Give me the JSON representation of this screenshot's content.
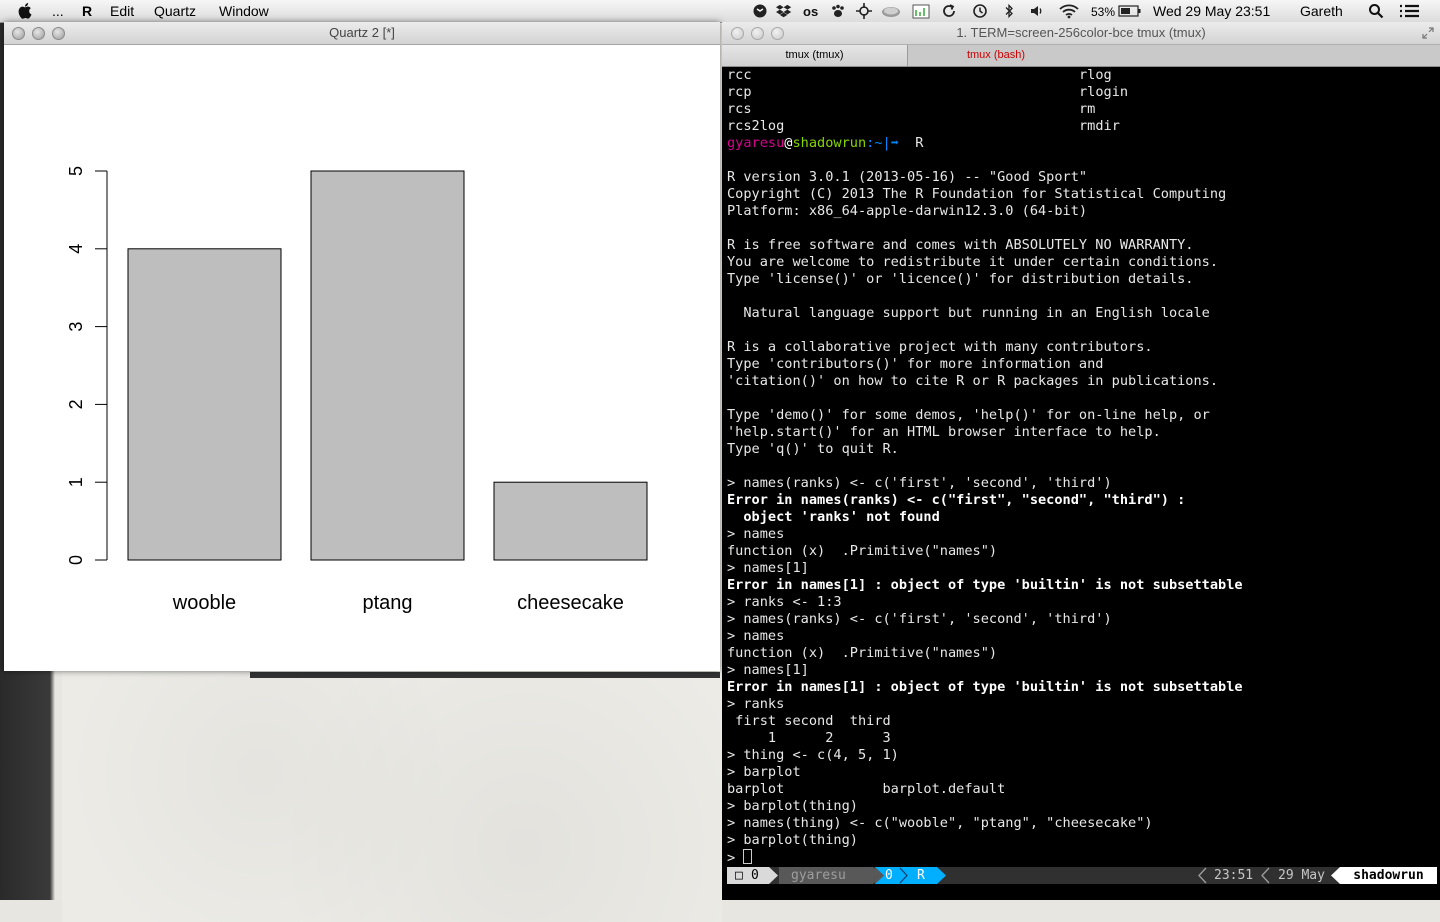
{
  "menubar": {
    "items": [
      "...",
      "R",
      "Edit",
      "Quartz",
      "Window"
    ],
    "battery": "53%",
    "clock": "Wed 29 May  23:51",
    "user": "Gareth"
  },
  "quartz_window": {
    "title": "Quartz 2 [*]"
  },
  "chart_data": {
    "type": "bar",
    "categories": [
      "wooble",
      "ptang",
      "cheesecake"
    ],
    "values": [
      4,
      5,
      1
    ],
    "yticks": [
      0,
      1,
      2,
      3,
      4,
      5
    ],
    "ylim": [
      0,
      5
    ],
    "bar_color": "#bebebe",
    "title": "",
    "xlabel": "",
    "ylabel": ""
  },
  "terminal": {
    "title": "1. TERM=screen-256color-bce tmux (tmux)",
    "tabs": [
      "tmux (tmux)",
      "tmux (bash)"
    ],
    "completion_rows": [
      [
        "rcc",
        "rlog"
      ],
      [
        "rcp",
        "rlogin"
      ],
      [
        "rcs",
        "rm"
      ],
      [
        "rcs2log",
        "rmdir"
      ]
    ],
    "prompt": {
      "user": "gyaresu",
      "at": "@",
      "host": "shadowrun",
      "path": ":~|➡",
      "command": "R"
    },
    "lines": [
      "",
      "R version 3.0.1 (2013-05-16) -- \"Good Sport\"",
      "Copyright (C) 2013 The R Foundation for Statistical Computing",
      "Platform: x86_64-apple-darwin12.3.0 (64-bit)",
      "",
      "R is free software and comes with ABSOLUTELY NO WARRANTY.",
      "You are welcome to redistribute it under certain conditions.",
      "Type 'license()' or 'licence()' for distribution details.",
      "",
      "  Natural language support but running in an English locale",
      "",
      "R is a collaborative project with many contributors.",
      "Type 'contributors()' for more information and",
      "'citation()' on how to cite R or R packages in publications.",
      "",
      "Type 'demo()' for some demos, 'help()' for on-line help, or",
      "'help.start()' for an HTML browser interface to help.",
      "Type 'q()' to quit R.",
      "",
      "> names(ranks) <- c('first', 'second', 'third')",
      "Error in names(ranks) <- c(\"first\", \"second\", \"third\") :",
      "  object 'ranks' not found",
      "> names",
      "function (x)  .Primitive(\"names\")",
      "> names[1]",
      "Error in names[1] : object of type 'builtin' is not subsettable",
      "> ranks <- 1:3",
      "> names(ranks) <- c('first', 'second', 'third')",
      "> names",
      "function (x)  .Primitive(\"names\")",
      "> names[1]",
      "Error in names[1] : object of type 'builtin' is not subsettable",
      "> ranks",
      " first second  third",
      "     1      2      3",
      "> thing <- c(4, 5, 1)",
      "> barplot",
      "barplot            barplot.default",
      "> barplot(thing)",
      "> names(thing) <- c(\"wooble\", \"ptang\", \"cheesecake\")",
      "> barplot(thing)",
      "> "
    ],
    "bold_line_indices": [
      20,
      21,
      25,
      31
    ],
    "status": {
      "window_index": "0",
      "session_user": "gyaresu",
      "pane_index": "0",
      "pane_name": "R",
      "time": "23:51",
      "date": "29 May",
      "host": "shadowrun"
    }
  },
  "colors": {
    "prompt_user": "#d7008f",
    "prompt_host": "#87d700",
    "prompt_path": "#0087ff",
    "status_accent": "#00afff"
  }
}
